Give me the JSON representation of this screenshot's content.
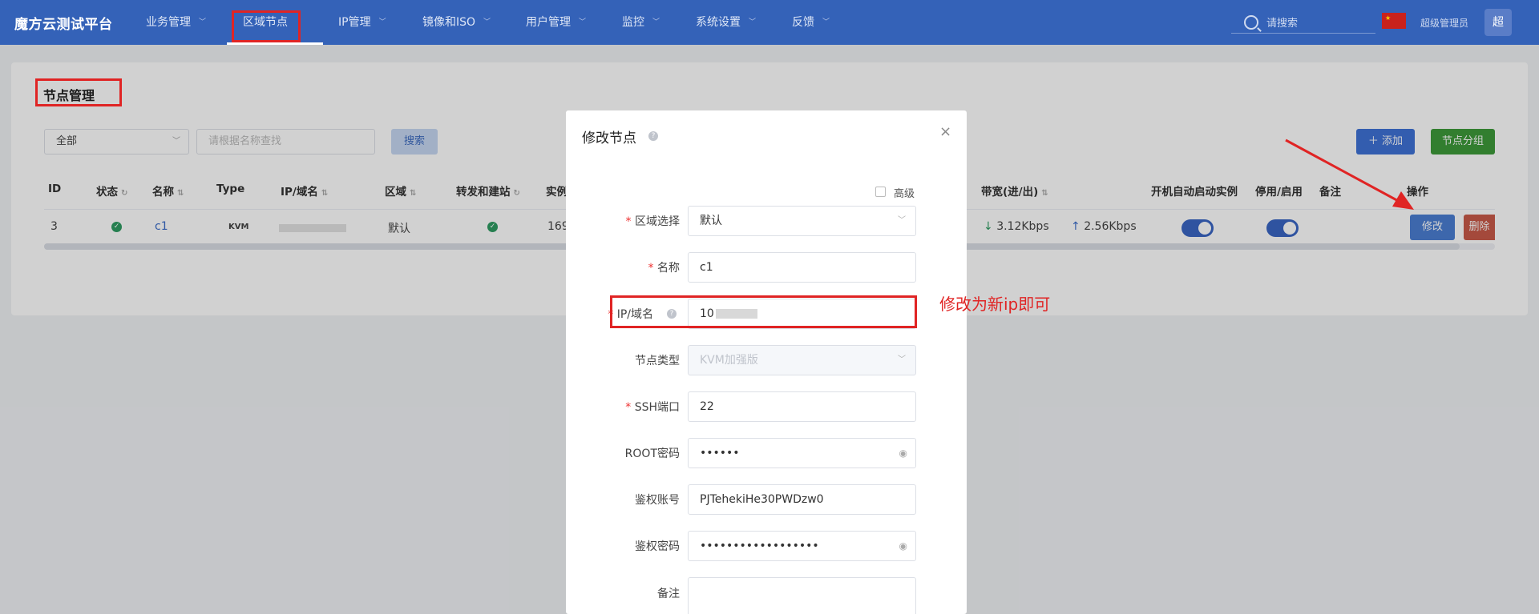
{
  "app": {
    "title": "魔方云测试平台"
  },
  "nav": [
    {
      "label": "业务管理",
      "has_menu": true
    },
    {
      "label": "区域节点",
      "has_menu": false,
      "active": true
    },
    {
      "label": "IP管理",
      "has_menu": true
    },
    {
      "label": "镜像和ISO",
      "has_menu": true
    },
    {
      "label": "用户管理",
      "has_menu": true
    },
    {
      "label": "监控",
      "has_menu": true
    },
    {
      "label": "系统设置",
      "has_menu": true
    },
    {
      "label": "反馈",
      "has_menu": true
    }
  ],
  "header": {
    "search_placeholder": "请搜索",
    "admin_label": "超级管理员",
    "avatar_text": "超",
    "flag": "★"
  },
  "page": {
    "title": "节点管理",
    "filter_select": "全部",
    "filter_placeholder": "请根据名称查找",
    "search_button": "搜索",
    "add_button": "＋ 添加",
    "group_button": "节点分组"
  },
  "table": {
    "columns": [
      "ID",
      "状态",
      "名称",
      "Type",
      "IP/域名",
      "区域",
      "转发和建站",
      "实例",
      "带宽(进/出)",
      "开机自动启动实例",
      "停用/启用",
      "备注",
      "操作"
    ],
    "row": {
      "id": "3",
      "status": "✓",
      "name": "c1",
      "type": "KVM",
      "ip": "",
      "region": "默认",
      "forward": "✓",
      "instances": "169",
      "bw_in": "3.12Kbps",
      "bw_out": "2.56Kbps",
      "autostart": true,
      "enabled": true,
      "note": ""
    },
    "actions": {
      "edit": "修改",
      "delete": "删除"
    }
  },
  "modal": {
    "title": "修改节点",
    "help": "?",
    "close": "×",
    "advanced_label": "高级",
    "fields": {
      "region": {
        "label": "区域选择",
        "required": true,
        "value": "默认"
      },
      "name": {
        "label": "名称",
        "required": true,
        "value": "c1"
      },
      "ip": {
        "label": "IP/域名",
        "required": true,
        "value": "10"
      },
      "node_type": {
        "label": "节点类型",
        "required": false,
        "value": "KVM加强版"
      },
      "ssh_port": {
        "label": "SSH端口",
        "required": true,
        "value": "22"
      },
      "root_pwd": {
        "label": "ROOT密码",
        "required": false,
        "value": "••••••"
      },
      "auth_account": {
        "label": "鉴权账号",
        "required": false,
        "value": "PJTehekiHe30PWDzw0"
      },
      "auth_pwd": {
        "label": "鉴权密码",
        "required": false,
        "value": "••••••••••••••••••"
      },
      "note": {
        "label": "备注",
        "required": false,
        "value": ""
      }
    },
    "req_mark": "*"
  },
  "annotation": {
    "text": "修改为新ip即可",
    "color": "#e02424"
  },
  "colors": {
    "topbar": "#3462b8",
    "primary": "#3f72d6",
    "success": "#3d9a3a",
    "danger": "#c85a48"
  }
}
